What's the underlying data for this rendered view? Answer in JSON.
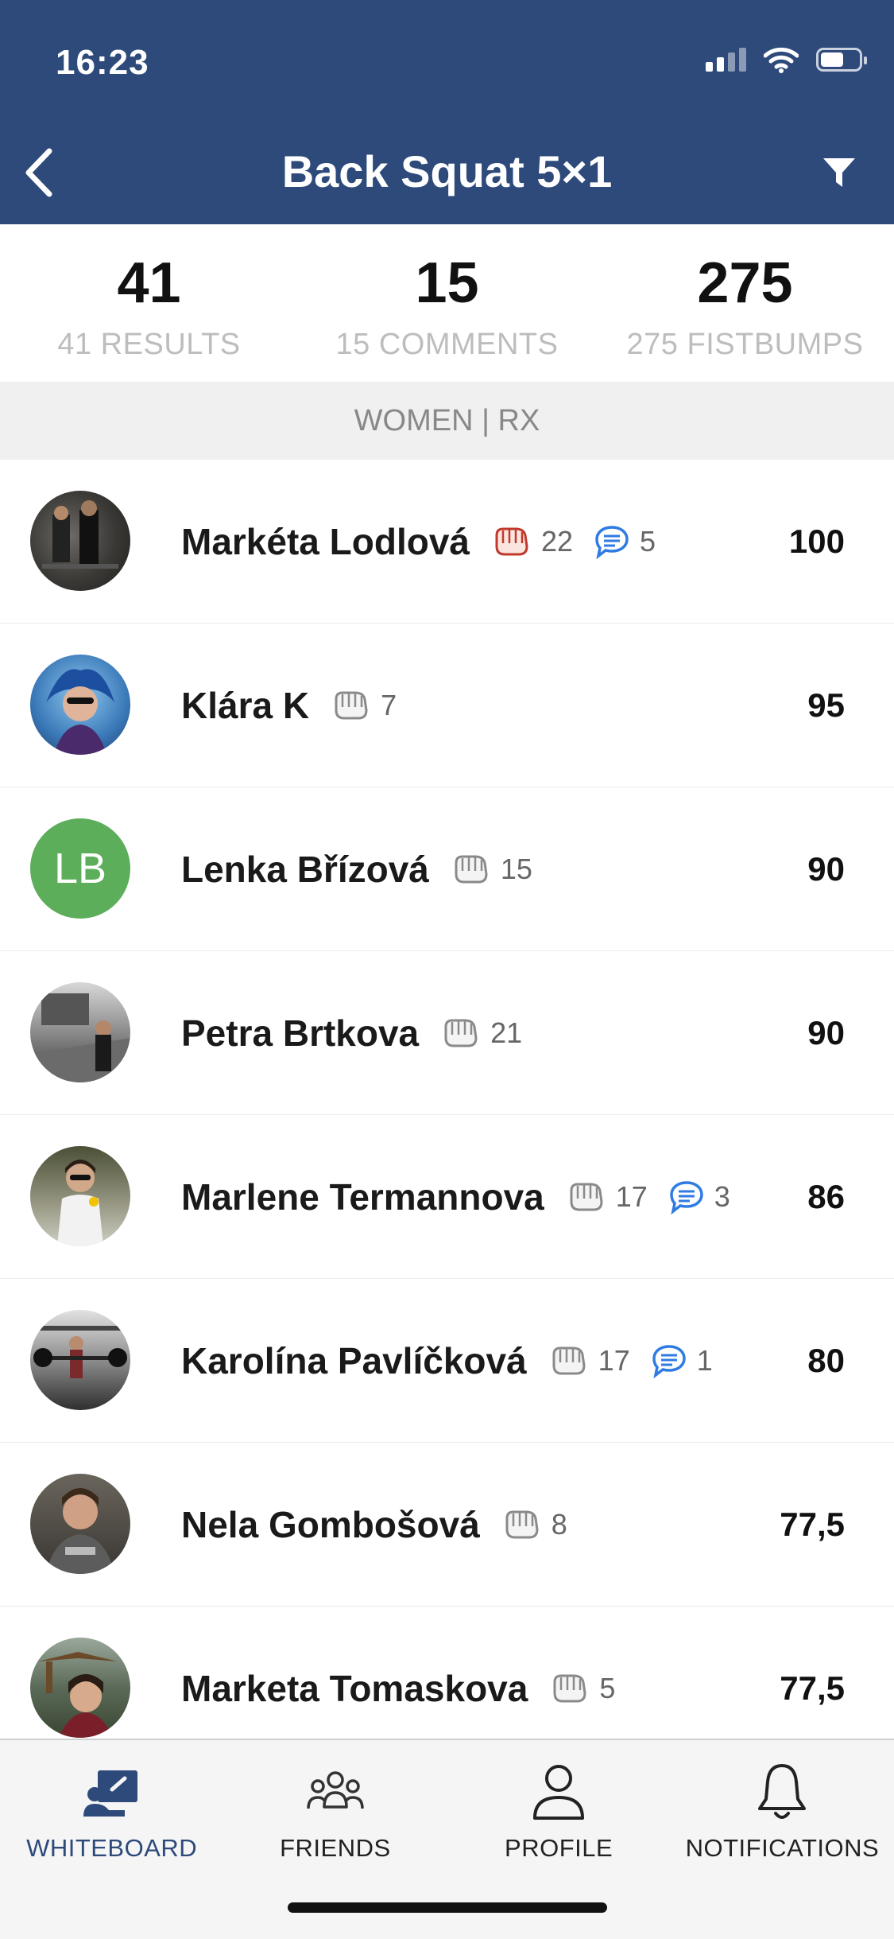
{
  "status_bar": {
    "time": "16:23"
  },
  "header": {
    "title": "Back Squat 5×1",
    "accent_color": "#2d4a7b"
  },
  "stats": [
    {
      "value": "41",
      "label": "41 RESULTS"
    },
    {
      "value": "15",
      "label": "15 COMMENTS"
    },
    {
      "value": "275",
      "label": "275 FISTBUMPS"
    }
  ],
  "section": {
    "label": "WOMEN | RX"
  },
  "results": [
    {
      "name": "Markéta Lodlová",
      "fistbumps": "22",
      "comments": "5",
      "score": "100",
      "fistbumped": true
    },
    {
      "name": "Klára K",
      "fistbumps": "7",
      "comments": null,
      "score": "95",
      "fistbumped": false
    },
    {
      "name": "Lenka Břízová",
      "fistbumps": "15",
      "comments": null,
      "score": "90",
      "initials": "LB",
      "fistbumped": false
    },
    {
      "name": "Petra Brtkova",
      "fistbumps": "21",
      "comments": null,
      "score": "90",
      "fistbumped": false
    },
    {
      "name": "Marlene Termannova",
      "fistbumps": "17",
      "comments": "3",
      "score": "86",
      "fistbumped": false
    },
    {
      "name": "Karolína Pavlíčková",
      "fistbumps": "17",
      "comments": "1",
      "score": "80",
      "fistbumped": false
    },
    {
      "name": "Nela Gombošová",
      "fistbumps": "8",
      "comments": null,
      "score": "77,5",
      "fistbumped": false
    },
    {
      "name": "Marketa Tomaskova",
      "fistbumps": "5",
      "comments": null,
      "score": "77,5",
      "fistbumped": false
    }
  ],
  "nav": [
    {
      "label": "WHITEBOARD",
      "icon": "whiteboard-icon",
      "active": true
    },
    {
      "label": "FRIENDS",
      "icon": "friends-icon",
      "active": false
    },
    {
      "label": "PROFILE",
      "icon": "profile-icon",
      "active": false
    },
    {
      "label": "NOTIFICATIONS",
      "icon": "bell-icon",
      "active": false
    }
  ]
}
